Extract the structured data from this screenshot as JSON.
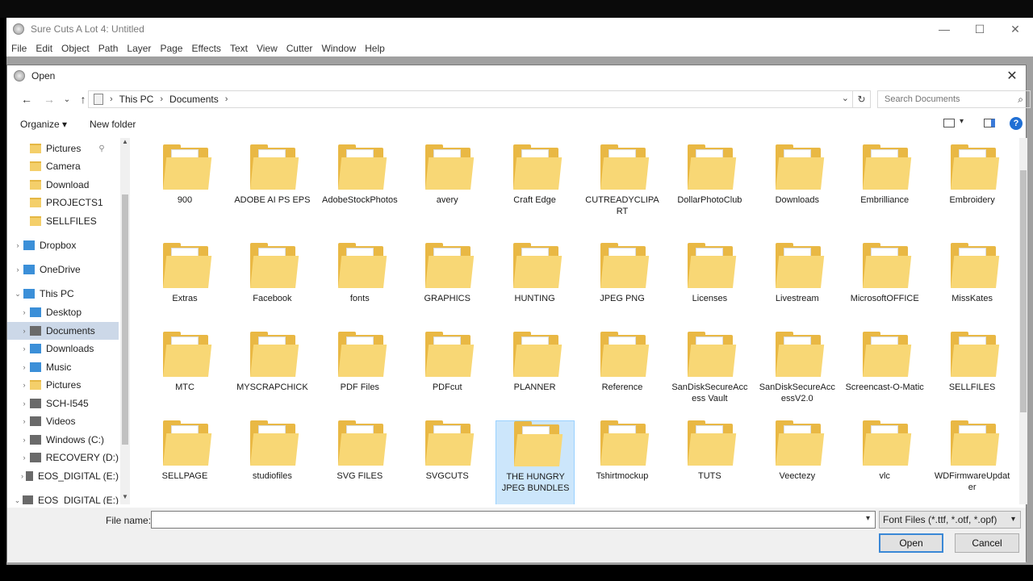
{
  "app": {
    "title": "Sure Cuts A Lot 4: Untitled",
    "menu": [
      "File",
      "Edit",
      "Object",
      "Path",
      "Layer",
      "Page",
      "Effects",
      "Text",
      "View",
      "Cutter",
      "Window",
      "Help"
    ],
    "window_buttons": [
      "—",
      "☐",
      "✕"
    ]
  },
  "dialog": {
    "title": "Open",
    "close": "✕",
    "nav": {
      "back": "←",
      "forward": "→",
      "recent": "⌄",
      "up": "↑",
      "refresh": "↻"
    },
    "breadcrumb": [
      "This PC",
      "Documents"
    ],
    "search_placeholder": "Search Documents",
    "toolbar": {
      "organize": "Organize ▾",
      "new_folder": "New folder",
      "help": "?"
    },
    "nav_pane": [
      {
        "label": "Pictures",
        "icon": "pictures-icon",
        "indent": 1,
        "pinned": true
      },
      {
        "label": "Camera",
        "icon": "folder-icon",
        "indent": 1
      },
      {
        "label": "Download",
        "icon": "folder-icon",
        "indent": 1
      },
      {
        "label": "PROJECTS1",
        "icon": "folder-icon",
        "indent": 1
      },
      {
        "label": "SELLFILES",
        "icon": "folder-icon",
        "indent": 1
      },
      {
        "label": "Dropbox",
        "icon": "dropbox-icon",
        "indent": 0,
        "expandable": true
      },
      {
        "label": "OneDrive",
        "icon": "onedrive-icon",
        "indent": 0,
        "expandable": true
      },
      {
        "label": "This PC",
        "icon": "pc-icon",
        "indent": 0,
        "expanded": true
      },
      {
        "label": "Desktop",
        "icon": "desktop-icon",
        "indent": 1,
        "expandable": true
      },
      {
        "label": "Documents",
        "icon": "documents-icon",
        "indent": 1,
        "expandable": true,
        "selected": true
      },
      {
        "label": "Downloads",
        "icon": "downloads-icon",
        "indent": 1,
        "expandable": true
      },
      {
        "label": "Music",
        "icon": "music-icon",
        "indent": 1,
        "expandable": true
      },
      {
        "label": "Pictures",
        "icon": "pictures-icon",
        "indent": 1,
        "expandable": true
      },
      {
        "label": "SCH-I545",
        "icon": "phone-icon",
        "indent": 1,
        "expandable": true
      },
      {
        "label": "Videos",
        "icon": "videos-icon",
        "indent": 1,
        "expandable": true
      },
      {
        "label": "Windows (C:)",
        "icon": "drive-icon",
        "indent": 1,
        "expandable": true
      },
      {
        "label": "RECOVERY (D:)",
        "icon": "drive-icon",
        "indent": 1,
        "expandable": true
      },
      {
        "label": "EOS_DIGITAL (E:)",
        "icon": "sd-card-icon",
        "indent": 1,
        "expandable": true
      },
      {
        "label": "EOS_DIGITAL (E:)",
        "icon": "sd-card-icon",
        "indent": 0,
        "expanded": true
      }
    ],
    "folders": [
      "900",
      "ADOBE AI PS EPS",
      "AdobeStockPhotos",
      "avery",
      "Craft Edge",
      "CUTREADYCLIPART",
      "DollarPhotoClub",
      "Downloads",
      "Embrilliance",
      "Embroidery",
      "Extras",
      "Facebook",
      "fonts",
      "GRAPHICS",
      "HUNTING",
      "JPEG PNG",
      "Licenses",
      "Livestream",
      "MicrosoftOFFICE",
      "MissKates",
      "MTC",
      "MYSCRAPCHICK",
      "PDF Files",
      "PDFcut",
      "PLANNER",
      "Reference",
      "SanDiskSecureAccess Vault",
      "SanDiskSecureAccessV2.0",
      "Screencast-O-Matic",
      "SELLFILES",
      "SELLPAGE",
      "studiofiles",
      "SVG FILES",
      "SVGCUTS",
      "THE HUNGRY JPEG BUNDLES",
      "Tshirtmockup",
      "TUTS",
      "Veectezy",
      "vlc",
      "WDFirmwareUpdater"
    ],
    "selected_folder": "THE HUNGRY JPEG BUNDLES",
    "file_name_label": "File name:",
    "file_name_value": "",
    "file_type": "Font Files (*.ttf, *.otf, *.opf)",
    "open_button": "Open",
    "cancel_button": "Cancel"
  }
}
